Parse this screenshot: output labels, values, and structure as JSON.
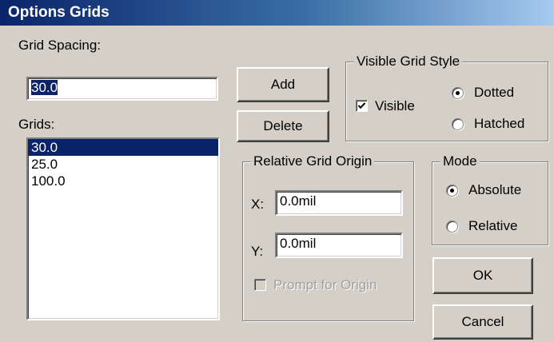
{
  "window": {
    "title": "Options Grids"
  },
  "grid_spacing": {
    "label": "Grid Spacing:",
    "value": "30.0"
  },
  "grids": {
    "label": "Grids:",
    "items": [
      "30.0",
      "25.0",
      "100.0"
    ],
    "selected": "30.0"
  },
  "buttons": {
    "add": "Add",
    "delete": "Delete",
    "ok": "OK",
    "cancel": "Cancel"
  },
  "visible_grid_style": {
    "title": "Visible Grid Style",
    "visible_label": "Visible",
    "visible_checked": true,
    "dotted_label": "Dotted",
    "hatched_label": "Hatched",
    "selected": "Dotted"
  },
  "relative_grid_origin": {
    "title": "Relative Grid Origin",
    "x_label": "X:",
    "x_value": "0.0mil",
    "y_label": "Y:",
    "y_value": "0.0mil",
    "prompt_label": "Prompt for Origin",
    "prompt_enabled": false
  },
  "mode": {
    "title": "Mode",
    "absolute_label": "Absolute",
    "relative_label": "Relative",
    "selected": "Absolute"
  },
  "colors": {
    "title_bar_start": "#0a246a",
    "dialog_bg": "#d4d0c8",
    "selection": "#0a246a"
  }
}
